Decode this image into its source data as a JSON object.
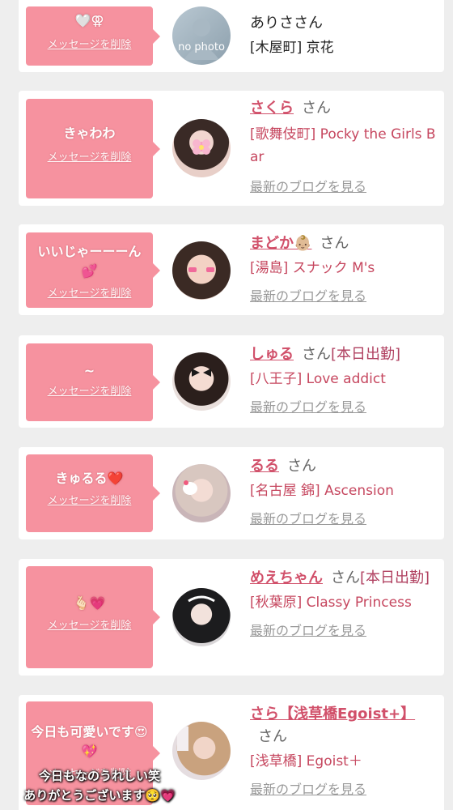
{
  "delete_label": "メッセージを削除",
  "blog_label": "最新のブログを見る",
  "suffix": "さん",
  "colors": {
    "bubble": "#f6929f",
    "name": "#d1506a",
    "background": "#eeeeee"
  },
  "cards": [
    {
      "message": "🤍⚢",
      "name": "ありさ",
      "note": "",
      "shop": "[木屋町] 京花",
      "avatar": "no-photo",
      "avatar_text": "no photo"
    },
    {
      "message": "きゃわわ",
      "name": "さくら",
      "note": "",
      "shop": "[歌舞伎町] Pocky the Girls Bar",
      "avatar": "girl-photo"
    },
    {
      "message": "いいじゃーーーん💕",
      "name": "まどか👶🏼",
      "note": "",
      "shop": "[湯島] スナック M's",
      "avatar": "girl-photo"
    },
    {
      "message": "~",
      "name": "しゅる",
      "note": "[本日出勤]",
      "shop": "[八王子] Love addict",
      "avatar": "girl-photo"
    },
    {
      "message": "きゅるる❤️",
      "name": "るる",
      "note": "",
      "shop": "[名古屋 錦] Ascension",
      "avatar": "girl-photo"
    },
    {
      "message": "🫰🏻💗",
      "name": "めえちゃん",
      "note": "[本日出勤]",
      "shop": "[秋葉原] Classy Princess",
      "avatar": "girl-photo"
    },
    {
      "message": "今日も可愛いです😍💖",
      "name": "さら【浅草橋Egoist+】",
      "note": "",
      "shop": "[浅草橋] Egoist＋",
      "avatar": "girl-photo"
    }
  ],
  "overlay_text": [
    "今日もなのうれしい笑",
    "ありがとうございます🥺💗"
  ]
}
